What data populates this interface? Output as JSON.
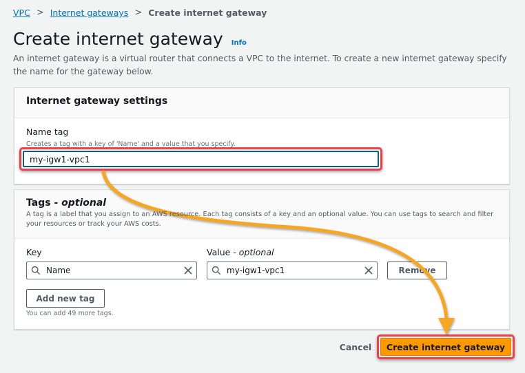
{
  "breadcrumb": {
    "items": [
      {
        "label": "VPC"
      },
      {
        "label": "Internet gateways"
      }
    ],
    "current": "Create internet gateway"
  },
  "page": {
    "title": "Create internet gateway",
    "info_label": "Info",
    "description": "An internet gateway is a virtual router that connects a VPC to the internet. To create a new internet gateway specify the name for the gateway below."
  },
  "settings_panel": {
    "title": "Internet gateway settings",
    "name_tag": {
      "label": "Name tag",
      "description": "Creates a tag with a key of 'Name' and a value that you specify.",
      "value": "my-igw1-vpc1"
    }
  },
  "tags_panel": {
    "title": "Tags - ",
    "title_optional": "optional",
    "description": "A tag is a label that you assign to an AWS resource. Each tag consists of a key and an optional value. You can use tags to search and filter your resources or track your AWS costs.",
    "key_label": "Key",
    "value_label": "Value - ",
    "value_label_optional": "optional",
    "tags": [
      {
        "key": "Name",
        "value": "my-igw1-vpc1"
      }
    ],
    "remove_label": "Remove",
    "add_label": "Add new tag",
    "limit_text": "You can add 49 more tags."
  },
  "footer": {
    "cancel_label": "Cancel",
    "create_label": "Create internet gateway"
  },
  "annotation": {
    "highlight_color": "#ef404a",
    "arrow_color": "#f5a623"
  }
}
